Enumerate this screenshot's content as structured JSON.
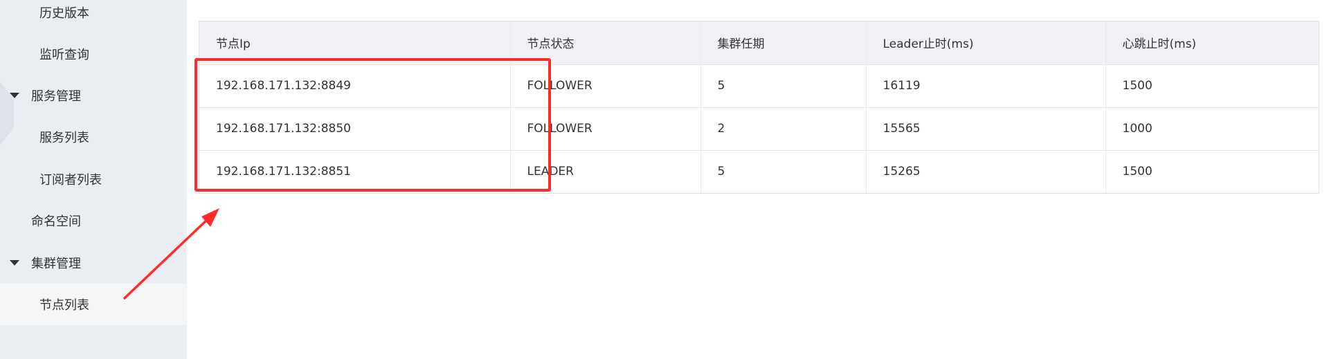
{
  "sidebar": {
    "items": [
      {
        "label": "历史版本",
        "type": "child"
      },
      {
        "label": "监听查询",
        "type": "child"
      },
      {
        "label": "服务管理",
        "type": "group"
      },
      {
        "label": "服务列表",
        "type": "child"
      },
      {
        "label": "订阅者列表",
        "type": "child"
      },
      {
        "label": "命名空间",
        "type": "top"
      },
      {
        "label": "集群管理",
        "type": "group"
      },
      {
        "label": "节点列表",
        "type": "child",
        "active": true
      }
    ]
  },
  "table": {
    "columns": [
      "节点Ip",
      "节点状态",
      "集群任期",
      "Leader止时(ms)",
      "心跳止时(ms)"
    ],
    "rows": [
      [
        "192.168.171.132:8849",
        "FOLLOWER",
        "5",
        "16119",
        "1500"
      ],
      [
        "192.168.171.132:8850",
        "FOLLOWER",
        "2",
        "15565",
        "1000"
      ],
      [
        "192.168.171.132:8851",
        "LEADER",
        "5",
        "15265",
        "1500"
      ]
    ]
  },
  "annotation": {
    "color": "#ff2a2a"
  },
  "colors": {
    "sidebar_bg": "#eaedf1",
    "table_header_bg": "#f0f1f4",
    "active_item_bg": "#f4f5f7"
  }
}
